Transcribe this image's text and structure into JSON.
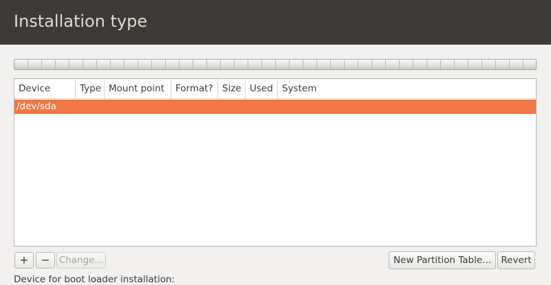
{
  "window": {
    "title": "Installation type"
  },
  "table": {
    "columns": [
      "Device",
      "Type",
      "Mount point",
      "Format?",
      "Size",
      "Used",
      "System"
    ],
    "rows": [
      {
        "device": "/dev/sda",
        "type": "",
        "mount_point": "",
        "format": "",
        "size": "",
        "used": "",
        "system": "",
        "selected": true
      }
    ]
  },
  "toolbar": {
    "add_label": "+",
    "remove_label": "−",
    "change_label": "Change...",
    "new_partition_table_label": "New Partition Table...",
    "revert_label": "Revert"
  },
  "boot_loader": {
    "label": "Device for boot loader installation:"
  },
  "colors": {
    "header_bg": "#3c3b37",
    "selection": "#f07746",
    "background": "#f2f1f0"
  }
}
